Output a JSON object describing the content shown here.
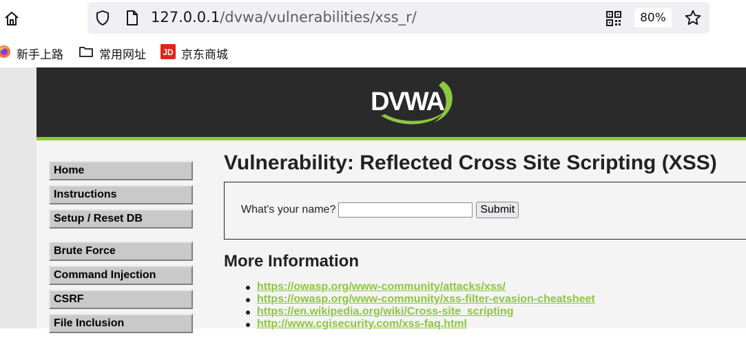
{
  "browser": {
    "url_host": "127.0.0.1",
    "url_path": "/dvwa/vulnerabilities/xss_r/",
    "zoom": "80%",
    "icons": [
      "home-icon",
      "shield-icon",
      "page-icon",
      "qr-code-icon",
      "star-icon"
    ]
  },
  "bookmarks": [
    {
      "label": "新手上路",
      "icon": "firefox-icon"
    },
    {
      "label": "常用网址",
      "icon": "folder-icon"
    },
    {
      "label": "京东商城",
      "icon": "jd-icon"
    }
  ],
  "header": {
    "logo_text": "DVWA",
    "accent_color": "#8dc63f"
  },
  "menu": {
    "group1": [
      "Home",
      "Instructions",
      "Setup / Reset DB"
    ],
    "group2": [
      "Brute Force",
      "Command Injection",
      "CSRF",
      "File Inclusion"
    ]
  },
  "main": {
    "title": "Vulnerability: Reflected Cross Site Scripting (XSS)",
    "form": {
      "label": "What's your name?",
      "input_value": "",
      "submit_label": "Submit"
    },
    "more_info_heading": "More Information",
    "links": [
      "https://owasp.org/www-community/attacks/xss/",
      "https://owasp.org/www-community/xss-filter-evasion-cheatsheet",
      "https://en.wikipedia.org/wiki/Cross-site_scripting",
      "http://www.cgisecurity.com/xss-faq.html"
    ]
  }
}
